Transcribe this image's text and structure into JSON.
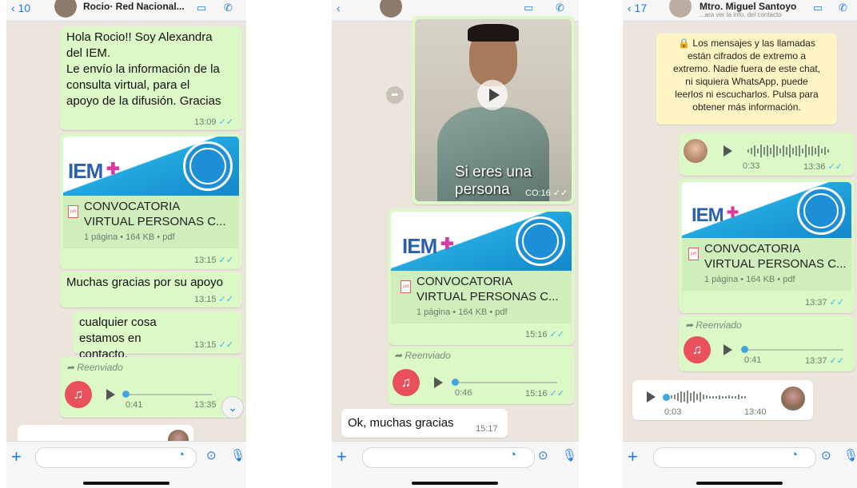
{
  "phone1": {
    "header": {
      "back": "‹ 10",
      "title": "Rocio· Red Nacional..."
    },
    "messages": [
      {
        "text": "Hola Rocio!! Soy Alexandra\ndel IEM.\nLe envío la información de la\nconsulta virtual, para el\napoyo de la difusión. Gracias",
        "time": "13:09"
      },
      {
        "doc_name": "CONVOCATORIA\nVIRTUAL PERSONAS C...",
        "doc_meta": "1 página • 164 KB • pdf",
        "time": "13:15"
      },
      {
        "text": "Muchas gracias por su apoyo",
        "time": "13:15"
      },
      {
        "text": "cualquier cosa estamos en\ncontacto.",
        "time": "13:15"
      },
      {
        "forwarded": "Reenviado",
        "duration": "0:41",
        "time": "13:35"
      }
    ]
  },
  "phone2": {
    "video": {
      "caption": "Si eres una\npersona",
      "time": "CO:16"
    },
    "messages": [
      {
        "doc_name": "CONVOCATORIA\nVIRTUAL PERSONAS C...",
        "doc_meta": "1 página • 164 KB • pdf",
        "time": "15:16"
      },
      {
        "forwarded": "Reenviado",
        "duration": "0:46",
        "time": "15:16"
      },
      {
        "text": "Ok, muchas gracias",
        "time": "15:17"
      }
    ]
  },
  "phone3": {
    "header": {
      "back": "‹ 17",
      "title": "Mtro. Miguel Santoyo",
      "sub": "...ara ver la info. del contacto"
    },
    "system": "🔒 Los mensajes y las llamadas\nestán cifrados de extremo a\nextremo. Nadie fuera de este chat,\nni siquiera WhatsApp, puede\nleerlos ni escucharlos. Pulsa para\nobtener más información.",
    "messages": [
      {
        "duration": "0:33",
        "time": "13:36"
      },
      {
        "doc_name": "CONVOCATORIA\nVIRTUAL PERSONAS C...",
        "doc_meta": "1 página • 164 KB • pdf",
        "time": "13:37"
      },
      {
        "forwarded": "Reenviado",
        "duration": "0:41",
        "time": "13:37"
      },
      {
        "duration": "0:03",
        "time": "13:40"
      }
    ]
  },
  "common": {
    "logo_text": "IEM",
    "pdf_label": "pdf",
    "tick": "✓✓"
  }
}
